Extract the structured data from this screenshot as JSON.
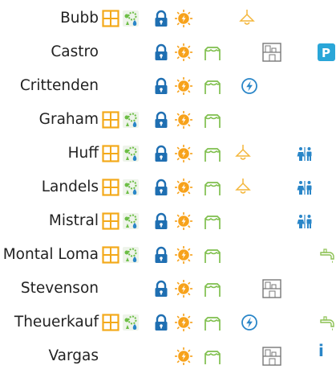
{
  "rooms": [
    {
      "name": "Bubb",
      "icons": [
        "window",
        "heating",
        "lock",
        "power",
        "lamp-right"
      ]
    },
    {
      "name": "Castro",
      "icons": [
        "lock",
        "power",
        "tent",
        "storage",
        "parking"
      ]
    },
    {
      "name": "Crittenden",
      "icons": [
        "lock",
        "power",
        "tent",
        "bolt"
      ]
    },
    {
      "name": "Graham",
      "icons": [
        "window",
        "heating",
        "lock",
        "power",
        "tent"
      ]
    },
    {
      "name": "Huff",
      "icons": [
        "window",
        "heating",
        "lock",
        "power",
        "tent",
        "lamp",
        "wc"
      ]
    },
    {
      "name": "Landels",
      "icons": [
        "window",
        "heating",
        "lock",
        "power",
        "tent",
        "lamp",
        "wc"
      ]
    },
    {
      "name": "Mistral",
      "icons": [
        "window",
        "heating",
        "lock",
        "power",
        "tent",
        "wc"
      ]
    },
    {
      "name": "Montal Loma",
      "icons": [
        "window",
        "heating",
        "lock",
        "power",
        "tent",
        "tap"
      ]
    },
    {
      "name": "Stevenson",
      "icons": [
        "lock",
        "power",
        "tent",
        "storage"
      ]
    },
    {
      "name": "Theuerkauf",
      "icons": [
        "window",
        "heating",
        "lock",
        "power",
        "tent",
        "bolt",
        "tap"
      ]
    },
    {
      "name": "Vargas",
      "icons": [
        "power",
        "tent",
        "storage"
      ]
    }
  ],
  "parking_label": "P",
  "stray_text": "i",
  "colors": {
    "window": "#f3a91a",
    "heat_green": "#6cbe45",
    "heat_blue": "#2a86c8",
    "lock": "#1f6fb2",
    "sun": "#f7a21b",
    "tent": "#7fbf4d",
    "lamp": "#f4b63a",
    "bolt": "#2a86c8",
    "wc": "#2a86c8",
    "storage": "#777777",
    "tap": "#8cc152",
    "parking": "#2aa6d8"
  }
}
